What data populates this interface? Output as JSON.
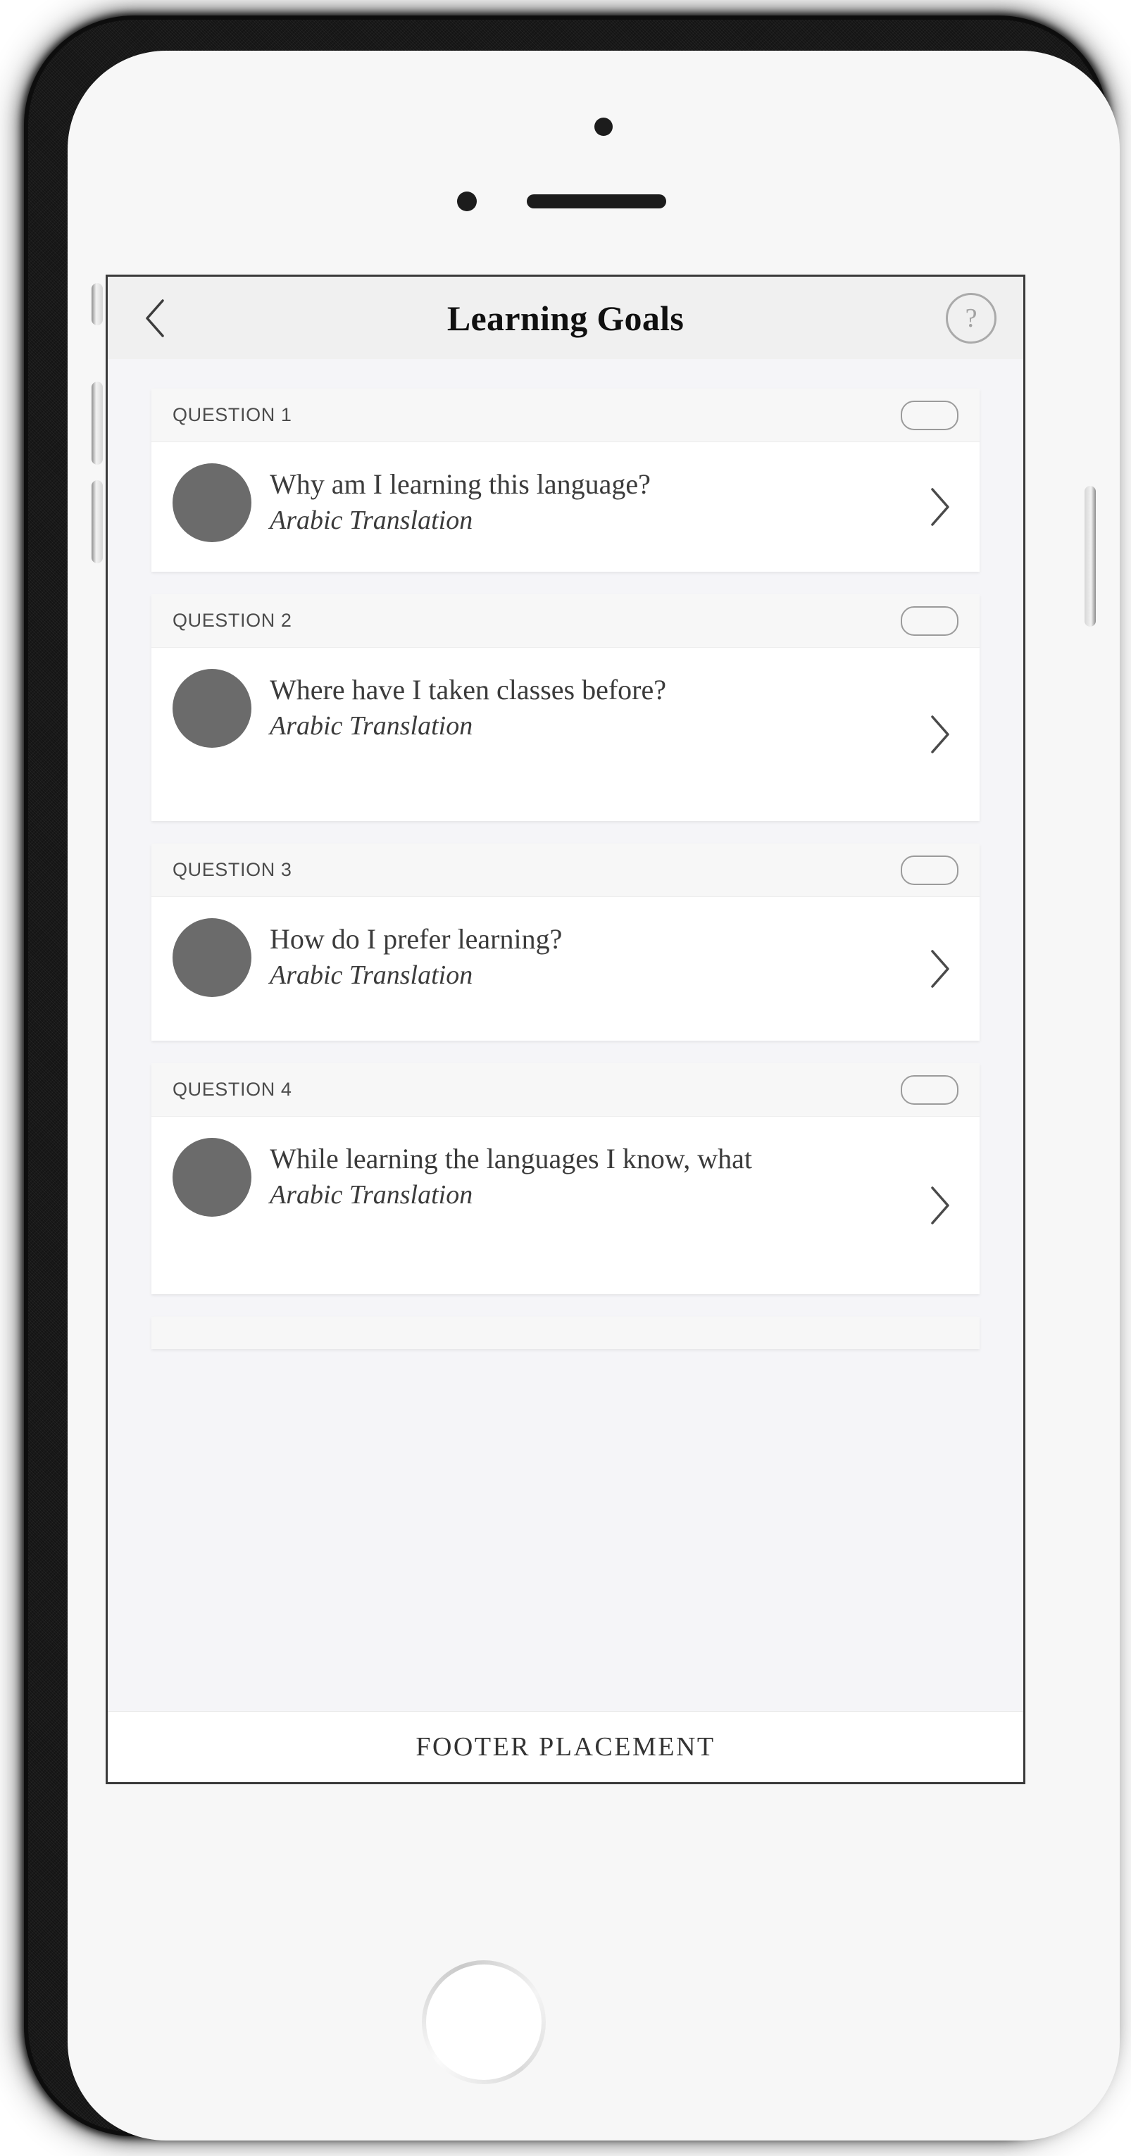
{
  "header": {
    "title": "Learning Goals",
    "back_icon": "chevron-left-icon",
    "help_label": "?",
    "help_icon": "help-circle-icon"
  },
  "questions": [
    {
      "label": "QUESTION 1",
      "question": "Why am I learning this language?",
      "translation": "Arabic Translation",
      "toggle_on": false,
      "wrap": false
    },
    {
      "label": "QUESTION 2",
      "question": "Where have I taken classes before?",
      "translation": "Arabic Translation",
      "toggle_on": false,
      "wrap": true
    },
    {
      "label": "QUESTION 3",
      "question": "How do I prefer learning?",
      "translation": "Arabic Translation",
      "toggle_on": false,
      "wrap": false
    },
    {
      "label": "QUESTION 4",
      "question": "While learning the languages I know, what",
      "translation": "Arabic Translation",
      "toggle_on": false,
      "wrap": true
    }
  ],
  "footer": {
    "label": "FOOTER PLACEMENT"
  },
  "device": {
    "home_button": "home-button",
    "power_button": "power-button",
    "volume_up": "volume-up-button",
    "volume_down": "volume-down-button",
    "mute_switch": "mute-switch"
  },
  "colors": {
    "screen_background": "#f5f5f8",
    "header_background": "#f0f0f0",
    "card_background": "#ffffff",
    "card_header_background": "#f7f7f7",
    "avatar": "#6b6b6b",
    "text_primary": "#3b3b3b",
    "label_text": "#4c4c4c",
    "toggle_border": "#9b9b9b",
    "screen_border": "#3a3a3a"
  }
}
